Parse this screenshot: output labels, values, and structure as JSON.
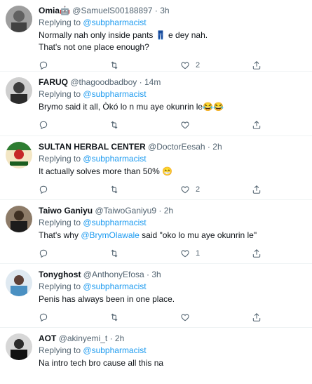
{
  "tweets": [
    {
      "name": "Omia🤖",
      "handle": "@SamuelS00188897",
      "sep": "·",
      "time": "3h",
      "replying_prefix": "Replying to",
      "replying_to": "@subpharmacist",
      "line1": "Normally nah only inside pants 👖 e dey nah.",
      "line2": "That's not one place enough?",
      "reply_count": "",
      "retweet_count": "",
      "like_count": "2",
      "avatar_color": "#8a8a8a"
    },
    {
      "name": "FARUQ",
      "handle": "@thagoodbadboy",
      "sep": "·",
      "time": "14m",
      "replying_prefix": "Replying to",
      "replying_to": "@subpharmacist",
      "line1": "Brymo said it all, Òkó lo n mu aye okunrin le😂😂",
      "reply_count": "",
      "retweet_count": "",
      "like_count": "",
      "avatar_color": "#5a5a5a"
    },
    {
      "name": "SULTAN HERBAL CENTER",
      "handle": "@DoctorEesah",
      "sep": "·",
      "time": "2h",
      "replying_prefix": "Replying to",
      "replying_to": "@subpharmacist",
      "line1": "It actually solves more than 50% 😁",
      "reply_count": "",
      "retweet_count": "",
      "like_count": "2",
      "avatar_color": "#c0392b"
    },
    {
      "name": "Taiwo Ganiyu",
      "handle": "@TaiwoGaniyu9",
      "sep": "·",
      "time": "2h",
      "replying_prefix": "Replying to",
      "replying_to": "@subpharmacist",
      "line1_pre": "That's why ",
      "line1_mention": "@BrymOlawale",
      "line1_post": " said \"oko lo mu aye okunrin le\"",
      "reply_count": "",
      "retweet_count": "",
      "like_count": "1",
      "avatar_color": "#3b3026"
    },
    {
      "name": "Tonyghost",
      "handle": "@AnthonyEfosa",
      "sep": "·",
      "time": "3h",
      "replying_prefix": "Replying to",
      "replying_to": "@subpharmacist",
      "line1": "Penis has always been in one place.",
      "reply_count": "",
      "retweet_count": "",
      "like_count": "",
      "avatar_color": "#7fa9c9"
    },
    {
      "name": "AOT",
      "handle": "@akinyemi_t",
      "sep": "·",
      "time": "2h",
      "replying_prefix": "Replying to",
      "replying_to": "@subpharmacist",
      "line1": "Na intro tech bro cause all this na",
      "avatar_color": "#2a2a2a"
    }
  ]
}
